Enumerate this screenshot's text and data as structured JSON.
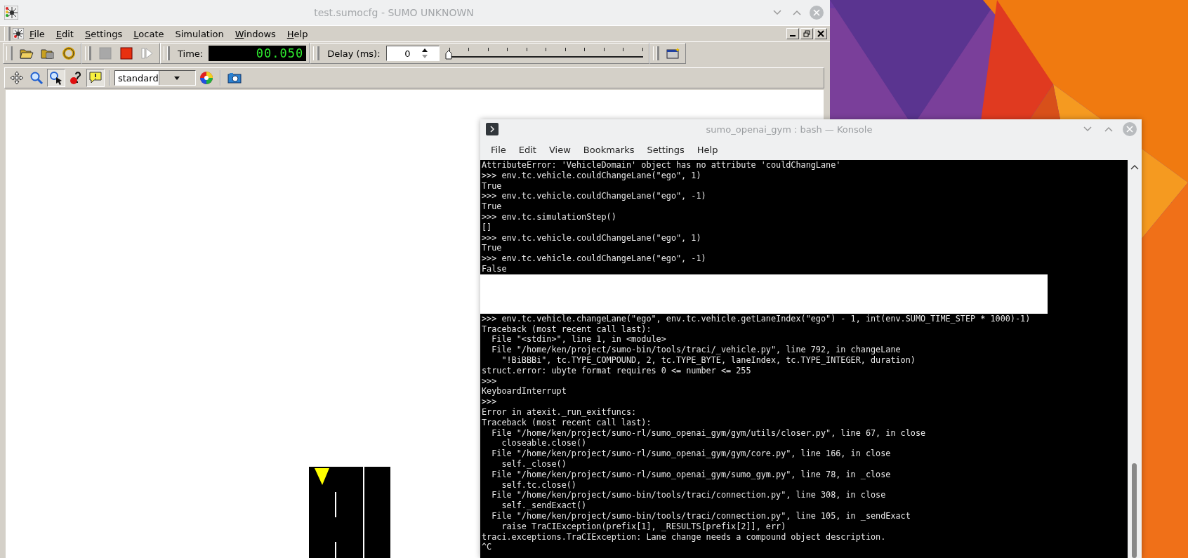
{
  "sumo_window": {
    "title": "test.sumocfg - SUMO UNKNOWN",
    "menu": [
      {
        "label": "File",
        "underline": true
      },
      {
        "label": "Edit",
        "underline": true
      },
      {
        "label": "Settings",
        "underline": true
      },
      {
        "label": "Locate",
        "underline": true
      },
      {
        "label": "Simulation",
        "underline": false
      },
      {
        "label": "Windows",
        "underline": true
      },
      {
        "label": "Help",
        "underline": true
      }
    ],
    "file_tools": [
      {
        "kind": "open"
      },
      {
        "kind": "open-network"
      },
      {
        "kind": "reload"
      }
    ],
    "run_tools": [
      {
        "kind": "start",
        "disabled": true
      },
      {
        "kind": "stop",
        "disabled": false
      },
      {
        "kind": "step",
        "disabled": true
      }
    ],
    "time_label": "Time:",
    "time_value": "00.050",
    "delay_label": "Delay (ms):",
    "delay_value": "0",
    "delay_slider": {
      "level": 0
    },
    "view_tools": [
      {
        "kind": "recenter",
        "pressed": false
      },
      {
        "kind": "zoom",
        "pressed": false
      },
      {
        "kind": "locate",
        "pressed": true
      },
      {
        "kind": "query",
        "pressed": false
      },
      {
        "kind": "tooltip",
        "pressed": true
      }
    ],
    "scheme": "standard"
  },
  "terminal": {
    "title": "sumo_openai_gym : bash — Konsole",
    "menu": [
      "File",
      "Edit",
      "View",
      "Bookmarks",
      "Settings",
      "Help"
    ],
    "lines_before": [
      "AttributeError: 'VehicleDomain' object has no attribute 'couldChangLane'",
      ">>> env.tc.vehicle.couldChangeLane(\"ego\", 1)",
      "True",
      ">>> env.tc.vehicle.couldChangeLane(\"ego\", -1)",
      "True",
      ">>> env.tc.simulationStep()",
      "[]",
      ">>> env.tc.vehicle.couldChangeLane(\"ego\", 1)",
      "True",
      ">>> env.tc.vehicle.couldChangeLane(\"ego\", -1)",
      "False"
    ],
    "lines_after": [
      ">>> env.tc.vehicle.changeLane(\"ego\", env.tc.vehicle.getLaneIndex(\"ego\") - 1, int(env.SUMO_TIME_STEP * 1000)-1)",
      "Traceback (most recent call last):",
      "  File \"<stdin>\", line 1, in <module>",
      "  File \"/home/ken/project/sumo-bin/tools/traci/_vehicle.py\", line 792, in changeLane",
      "    \"!BiBBBi\", tc.TYPE_COMPOUND, 2, tc.TYPE_BYTE, laneIndex, tc.TYPE_INTEGER, duration)",
      "struct.error: ubyte format requires 0 <= number <= 255",
      ">>>",
      "KeyboardInterrupt",
      ">>>",
      "Error in atexit._run_exitfuncs:",
      "Traceback (most recent call last):",
      "  File \"/home/ken/project/sumo-rl/sumo_openai_gym/gym/utils/closer.py\", line 67, in close",
      "    closeable.close()",
      "  File \"/home/ken/project/sumo-rl/sumo_openai_gym/gym/core.py\", line 166, in close",
      "    self._close()",
      "  File \"/home/ken/project/sumo-rl/sumo_openai_gym/sumo_gym.py\", line 78, in _close",
      "    self.tc.close()",
      "  File \"/home/ken/project/sumo-bin/tools/traci/connection.py\", line 308, in close",
      "    self._sendExact()",
      "  File \"/home/ken/project/sumo-bin/tools/traci/connection.py\", line 105, in _sendExact",
      "    raise TraCIException(prefix[1], _RESULTS[prefix[2]], err)",
      "traci.exceptions.TraCIException: Lane change needs a compound object description.",
      "^C"
    ]
  }
}
